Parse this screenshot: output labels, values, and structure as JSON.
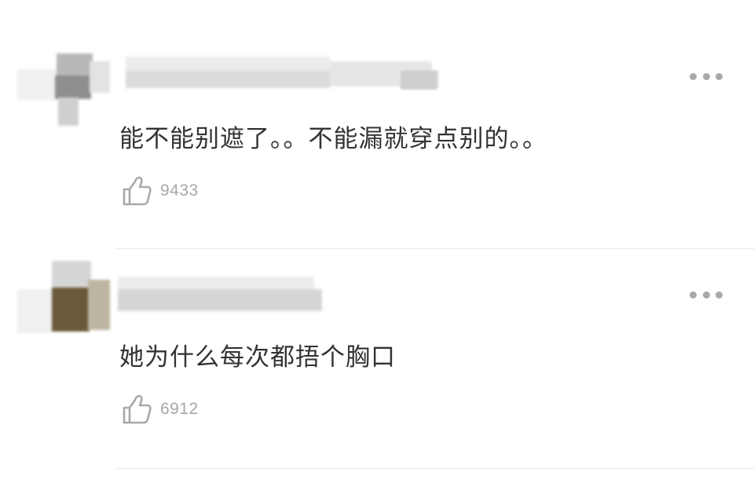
{
  "comments": [
    {
      "text": "能不能别遮了。。不能漏就穿点别的。。",
      "likes": "9433",
      "more_icon": "more-horizontal-icon",
      "like_icon": "thumbs-up-icon"
    },
    {
      "text": "她为什么每次都捂个胸口",
      "likes": "6912",
      "more_icon": "more-horizontal-icon",
      "like_icon": "thumbs-up-icon"
    }
  ],
  "colors": {
    "text": "#333333",
    "meta": "#a7a7a7",
    "icon": "#a9a9a9",
    "divider": "#e8e8e8"
  }
}
